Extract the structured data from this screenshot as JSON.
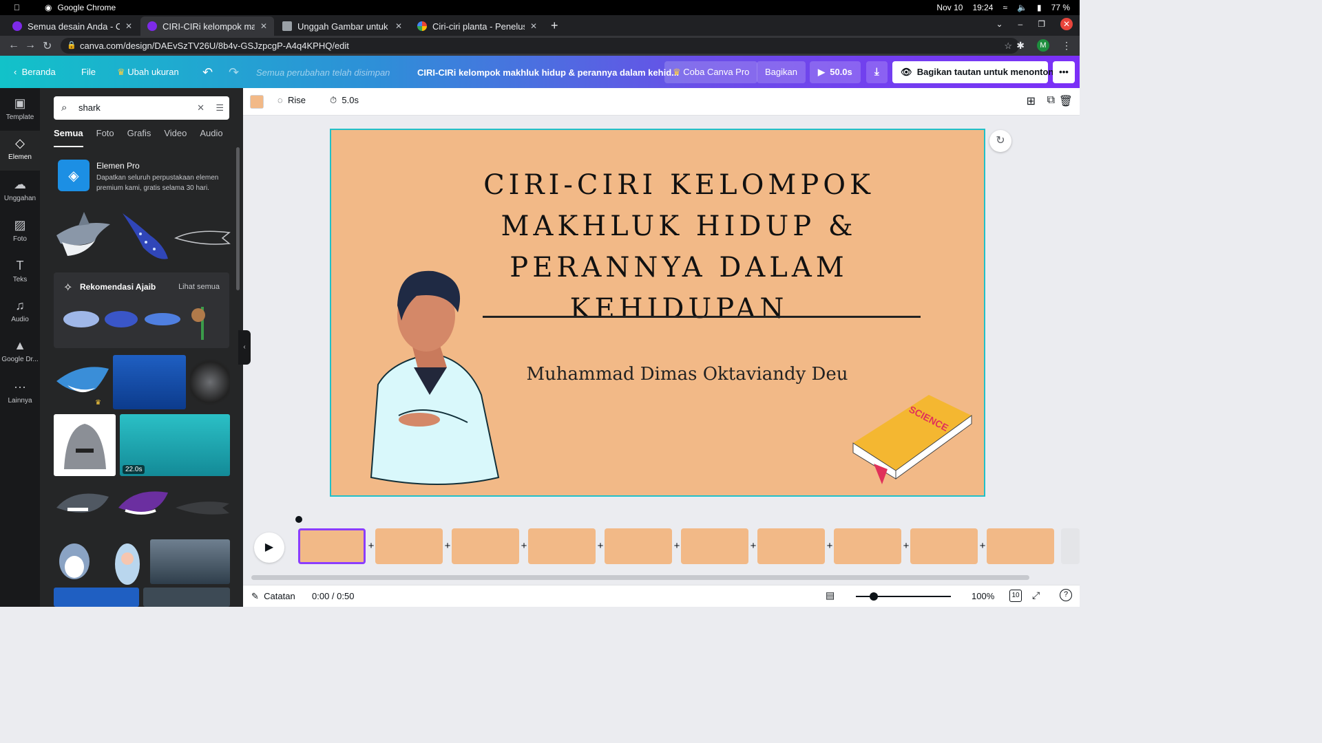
{
  "os": {
    "date": "Nov 10",
    "time": "19:24",
    "battery": "77 %",
    "browser_name": "Google Chrome"
  },
  "tabs": [
    {
      "title": "Semua desain Anda - Canva"
    },
    {
      "title": "CIRI-CIRi kelompok makhluk hidup"
    },
    {
      "title": "Unggah Gambar untuk Membuat"
    },
    {
      "title": "Ciri-ciri planta - Penelusuran"
    }
  ],
  "address": {
    "url": "canva.com/design/DAEvSzTV26U/8b4v-GSJzpcgP-A4q4KPHQ/edit",
    "avatar": "M"
  },
  "header": {
    "home": "Beranda",
    "file": "File",
    "resize": "Ubah ukuran",
    "saved": "Semua perubahan telah disimpan",
    "doc_title": "CIRI-CIRi kelompok makhluk hidup & perannya dalam kehid...",
    "try_pro": "Coba Canva Pro",
    "share": "Bagikan",
    "duration": "50.0s",
    "share_link": "Bagikan tautan untuk menonton",
    "more": "•••"
  },
  "rail": [
    {
      "label": "Template",
      "icon": "template-icon"
    },
    {
      "label": "Elemen",
      "icon": "elements-icon"
    },
    {
      "label": "Unggahan",
      "icon": "upload-icon"
    },
    {
      "label": "Foto",
      "icon": "photo-icon"
    },
    {
      "label": "Teks",
      "icon": "text-icon"
    },
    {
      "label": "Audio",
      "icon": "audio-icon"
    },
    {
      "label": "Google Dr...",
      "icon": "google-drive-icon"
    },
    {
      "label": "Lainnya",
      "icon": "more-icon"
    }
  ],
  "panel": {
    "search_value": "shark",
    "tabs": [
      "Semua",
      "Foto",
      "Grafis",
      "Video",
      "Audio"
    ],
    "promo_title": "Elemen Pro",
    "promo_desc": "Dapatkan seluruh perpustakaan elemen premium kami, gratis selama 30 hari.",
    "magic_title": "Rekomendasi Ajaib",
    "magic_see_all": "Lihat semua",
    "video_duration": "22.0s"
  },
  "toolbar": {
    "color": "#f2b987",
    "animation": "Rise",
    "timing": "5.0s"
  },
  "slide": {
    "title": "CIRI-CIRI KELOMPOK MAKHLUK HIDUP & PERANNYA DALAM KEHIDUPAN",
    "author": "Muhammad Dimas Oktaviandy Deu",
    "book_label": "SCIENCE",
    "background": "#f2b987"
  },
  "footer": {
    "notes": "Catatan",
    "time": "0:00 / 0:50",
    "zoom": "100%",
    "pages": "10"
  }
}
